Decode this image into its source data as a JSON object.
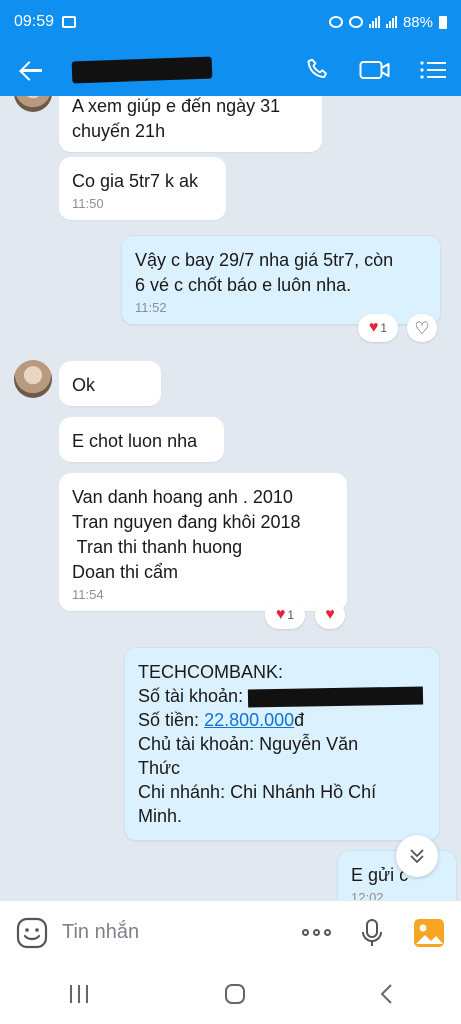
{
  "status": {
    "time": "09:59",
    "battery": "88%"
  },
  "header": {
    "back_icon": "back-arrow-icon",
    "call_icon": "phone-icon",
    "video_icon": "video-icon",
    "menu_icon": "menu-list-icon"
  },
  "messages": [
    {
      "side": "in",
      "text_lines": [
        "A xem giúp e đến ngày 31",
        "chuyến 21h"
      ]
    },
    {
      "side": "in",
      "text": "Co gia 5tr7 k ak",
      "time": "11:50"
    },
    {
      "side": "out",
      "text_lines": [
        "Vậy c bay 29/7 nha giá 5tr7, còn",
        "6 vé c chốt báo e luôn nha."
      ],
      "time": "11:52",
      "reaction_count": "1"
    },
    {
      "side": "in",
      "text": "Ok"
    },
    {
      "side": "in",
      "text": "E chot luon nha"
    },
    {
      "side": "in",
      "text_lines": [
        "Van danh hoang anh . 2010",
        "Tran nguyen đang khôi 2018",
        " Tran thi thanh huong",
        "Doan thi cẩm"
      ],
      "time": "11:54",
      "reaction_count": "1"
    },
    {
      "side": "out",
      "bank": "TECHCOMBANK:",
      "account_label": "Số tài khoản:",
      "amount_label": "Số tiền:",
      "amount": "22.800.000",
      "currency": "đ",
      "holder_lines": [
        "Chủ tài khoản: Nguyễn Văn",
        "Thức"
      ],
      "branch_lines": [
        "Chi nhánh: Chi Nhánh Hồ Chí",
        "Minh."
      ]
    },
    {
      "side": "out",
      "text": "E gửi c",
      "time": "12:02"
    }
  ],
  "composer": {
    "placeholder": "Tin nhắn"
  }
}
